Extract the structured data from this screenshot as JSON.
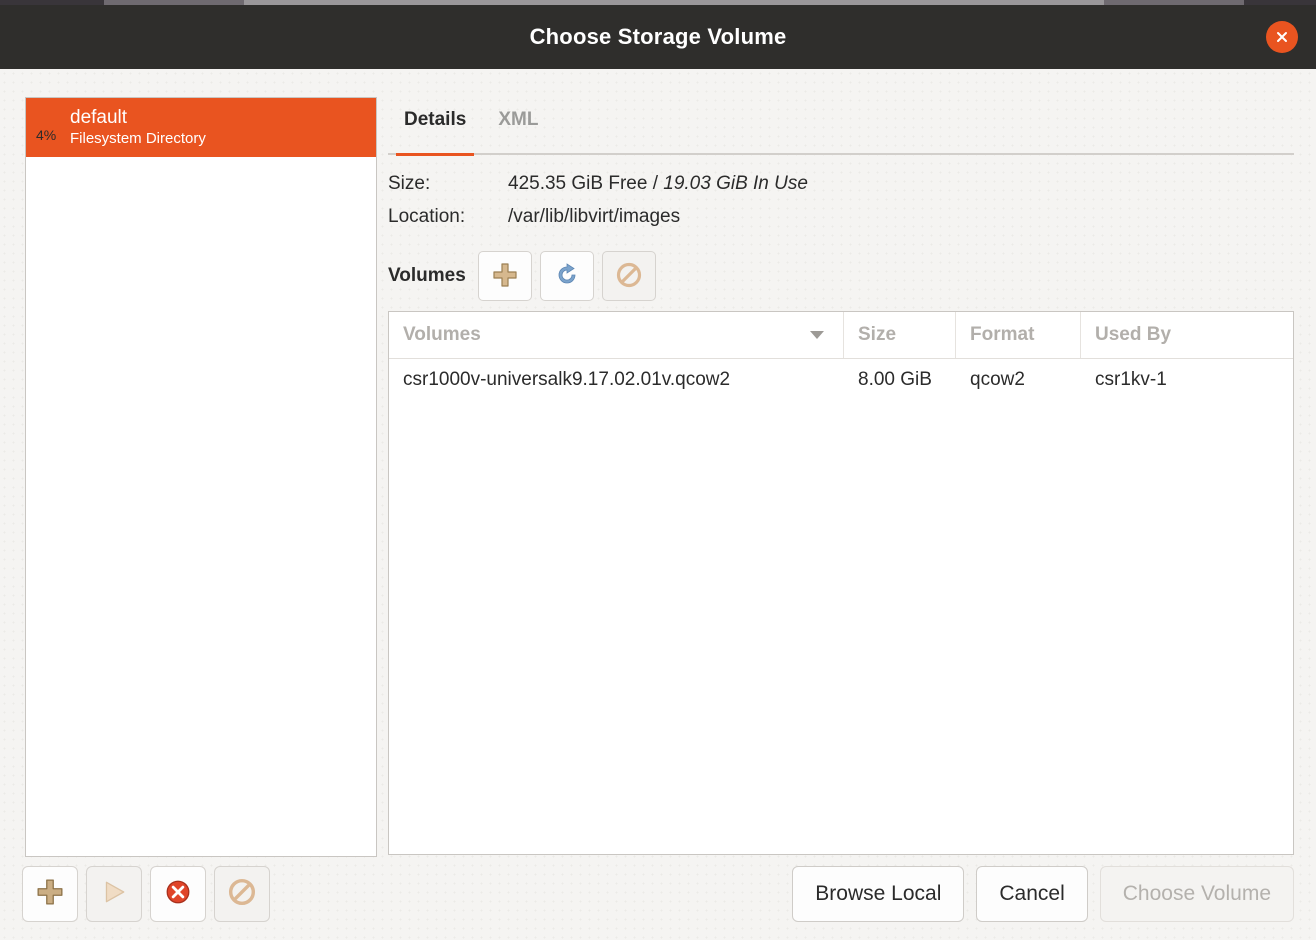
{
  "window": {
    "title": "Choose Storage Volume",
    "close_icon": "close-icon"
  },
  "pools": [
    {
      "usage": "4%",
      "name": "default",
      "type": "Filesystem Directory",
      "selected": true
    }
  ],
  "tabs": [
    {
      "label": "Details",
      "active": true
    },
    {
      "label": "XML",
      "active": false
    }
  ],
  "details": {
    "size_label": "Size:",
    "size_free": "425.35 GiB Free /",
    "size_inuse": "19.03 GiB In Use",
    "location_label": "Location:",
    "location_value": "/var/lib/libvirt/images"
  },
  "volumes_toolbar": {
    "label": "Volumes",
    "buttons": [
      {
        "icon": "plus-icon",
        "name": "new-volume-button",
        "enabled": true
      },
      {
        "icon": "refresh-icon",
        "name": "refresh-volumes-button",
        "enabled": true
      },
      {
        "icon": "delete-forbidden-icon",
        "name": "delete-volume-button",
        "enabled": false
      }
    ]
  },
  "volumes_table": {
    "columns": [
      "Volumes",
      "Size",
      "Format",
      "Used By"
    ],
    "sort_column": "Volumes",
    "sort_icon": "sort-descending-icon",
    "rows": [
      {
        "volume": "csr1000v-universalk9.17.02.01v.qcow2",
        "size": "8.00 GiB",
        "format": "qcow2",
        "used_by": "csr1kv-1"
      }
    ]
  },
  "bottom_toolbar": [
    {
      "icon": "plus-icon",
      "name": "add-pool-button",
      "enabled": true
    },
    {
      "icon": "play-icon",
      "name": "start-pool-button",
      "enabled": false
    },
    {
      "icon": "stop-icon",
      "name": "stop-pool-button",
      "enabled": true
    },
    {
      "icon": "delete-forbidden-icon",
      "name": "delete-pool-button",
      "enabled": false
    }
  ],
  "actions": {
    "browse_local": "Browse Local",
    "cancel": "Cancel",
    "choose_volume": "Choose Volume"
  },
  "colors": {
    "accent": "#e95420",
    "titlebar": "#2f2e2c",
    "background": "#f5f4f2"
  }
}
